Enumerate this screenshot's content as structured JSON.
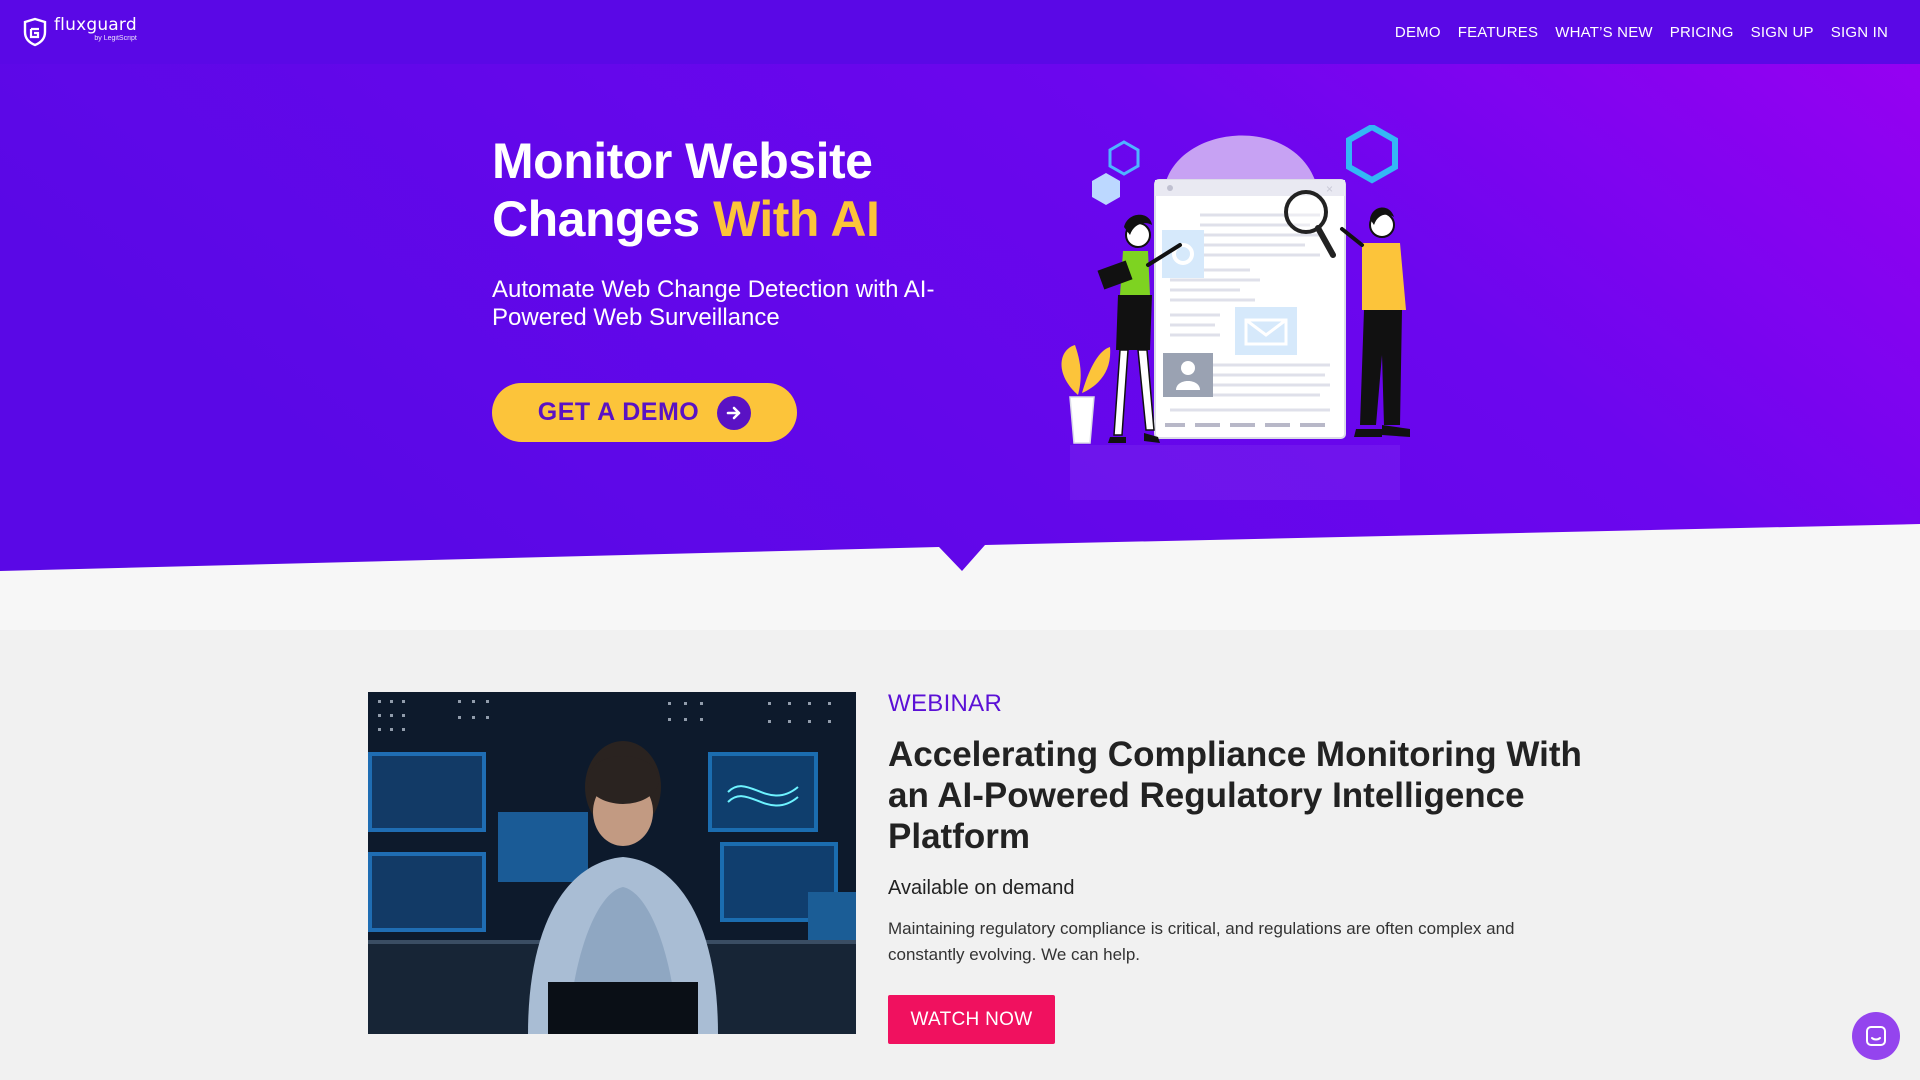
{
  "brand": {
    "name": "fluxguard",
    "tagline": "by LegitScript"
  },
  "nav": {
    "items": [
      {
        "label": "DEMO"
      },
      {
        "label": "FEATURES"
      },
      {
        "label": "WHAT’S NEW"
      },
      {
        "label": "PRICING"
      },
      {
        "label": "SIGN UP"
      },
      {
        "label": "SIGN IN"
      }
    ]
  },
  "hero": {
    "title_line1": "Monitor Website",
    "title_line2_plain": "Changes ",
    "title_line2_accent": "With AI",
    "subtitle": "Automate Web Change Detection with AI-Powered Web Surveillance",
    "cta_label": "GET A DEMO",
    "cta_icon": "arrow-right-circle-icon"
  },
  "webinar": {
    "eyebrow": "WEBINAR",
    "title": "Accelerating Compliance Monitoring With an AI-Powered Regulatory Intelligence Platform",
    "availability": "Available on demand",
    "description": "Maintaining regulatory compliance is critical, and regulations are often complex and constantly evolving. We can help.",
    "button_label": "WATCH NOW"
  },
  "chat": {
    "icon": "chat-icon"
  },
  "colors": {
    "nav_bg": "#5a08e6",
    "hero_gradient_start": "#5a08e6",
    "hero_gradient_end": "#9a00f2",
    "accent_yellow": "#fcc43a",
    "eyebrow_purple": "#5b10d6",
    "watch_button": "#f0115f",
    "chat_bubble": "#9444ee"
  }
}
